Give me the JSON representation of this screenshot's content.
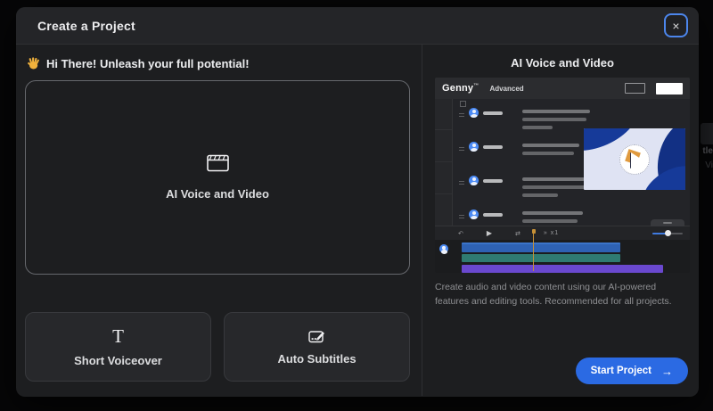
{
  "modal": {
    "title": "Create a Project",
    "close_glyph": "×"
  },
  "left": {
    "greeting": "Hi There! Unleash your full potential!",
    "greeting_icon": "wave-hand",
    "main_card": {
      "label": "AI Voice and Video",
      "icon": "clapperboard"
    },
    "cards": [
      {
        "label": "Short Voiceover",
        "icon_glyph": "T"
      },
      {
        "label": "Auto Subtitles",
        "icon": "subtitles-edit"
      }
    ]
  },
  "right": {
    "title": "AI Voice and Video",
    "description": "Create audio and video content using our AI-powered features and editing tools. Recommended for all projects.",
    "start_button": {
      "label": "Start Project",
      "arrow": "→"
    },
    "preview": {
      "logo": "Genny",
      "logo_mark": "™",
      "nav_label": "Advanced",
      "speed_label": "x1",
      "icons": {
        "undo": "↶",
        "play": "▶",
        "split": "⇄",
        "skip": "»"
      }
    }
  },
  "background": {
    "fragments": [
      "tle",
      "Vi"
    ]
  },
  "colors": {
    "accent-blue": "#2b6ae3",
    "track-blue": "#2e62b4",
    "track-teal": "#2f7b72",
    "track-purple": "#6a48cf",
    "avatar-blue": "#4c8bf5",
    "playhead": "#c79136",
    "video-bg": "#dfe3f3",
    "finger-blue": "#163a99",
    "orange": "#e09a3e"
  }
}
